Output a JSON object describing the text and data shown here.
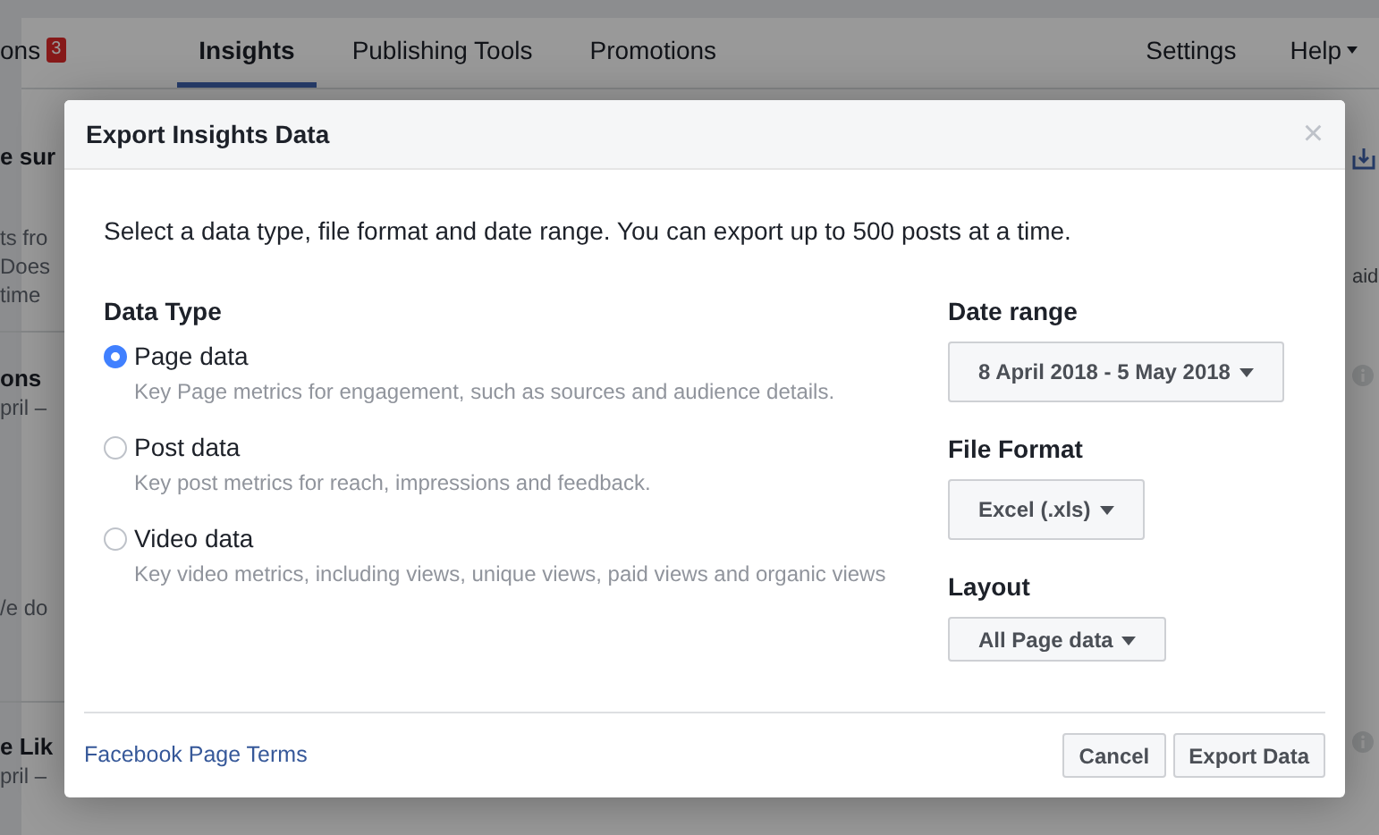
{
  "background": {
    "nav_tabs": [
      {
        "label": "ons",
        "badge": "3",
        "selected": false
      },
      {
        "label": "Insights",
        "selected": true
      },
      {
        "label": "Publishing Tools",
        "selected": false
      },
      {
        "label": "Promotions",
        "selected": false
      }
    ],
    "nav_right": [
      {
        "label": "Settings",
        "dropdown": false
      },
      {
        "label": "Help",
        "dropdown": true
      }
    ],
    "left_sections": [
      {
        "lines": [
          {
            "text": "e sur",
            "kind": "heading"
          }
        ]
      },
      {
        "lines": [
          {
            "text": "ts fro",
            "kind": "text"
          },
          {
            "text": "Does",
            "kind": "text"
          },
          {
            "text": "time",
            "kind": "text"
          }
        ]
      },
      {
        "lines": [
          {
            "text": "ons",
            "kind": "heading"
          },
          {
            "text": "pril –",
            "kind": "text"
          }
        ]
      },
      {
        "lines": [
          {
            "text": "/e do",
            "kind": "text"
          }
        ]
      },
      {
        "lines": [
          {
            "text": "e Lik",
            "kind": "heading"
          },
          {
            "text": "pril –",
            "kind": "text"
          }
        ]
      }
    ],
    "right_text": "aid"
  },
  "modal": {
    "title": "Export Insights Data",
    "close": "×",
    "intro": "Select a data type, file format and date range. You can export up to 500 posts at a time.",
    "data_type_label": "Data Type",
    "options": [
      {
        "label": "Page data",
        "description": "Key Page metrics for engagement, such as sources and audience details.",
        "selected": true
      },
      {
        "label": "Post data",
        "description": "Key post metrics for reach, impressions and feedback.",
        "selected": false
      },
      {
        "label": "Video data",
        "description": "Key video metrics, including views, unique views, paid views and organic views",
        "selected": false
      }
    ],
    "selects": [
      {
        "label": "Date range",
        "value": "8 April 2018 - 5 May 2018"
      },
      {
        "label": "File Format",
        "value": "Excel (.xls)"
      },
      {
        "label": "Layout",
        "value": "All Page data"
      }
    ],
    "footer_link": "Facebook Page Terms",
    "buttons": [
      "Cancel",
      "Export Data"
    ]
  }
}
